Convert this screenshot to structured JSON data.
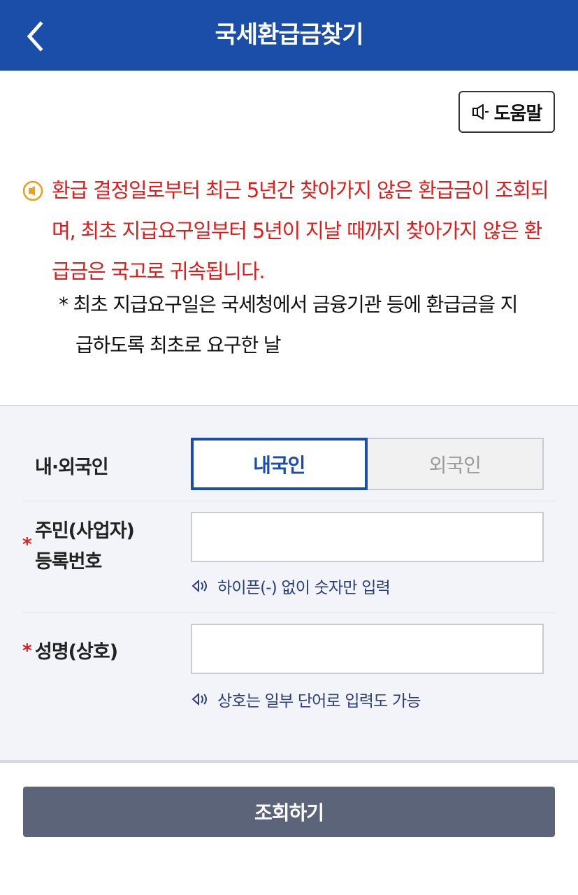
{
  "header": {
    "title": "국세환급금찾기"
  },
  "help": {
    "label": "도움말"
  },
  "notice": {
    "lines": [
      "환급 결정일로부터 최근 5년간 찾아가지 않은 환급금이 조회되",
      "며, 최초 지급요구일부터 5년이 지날 때까지 찾아가지 않은 환",
      "급금은 국고로 귀속됩니다."
    ],
    "sub_lines": [
      "* 최초 지급요구일은 국세청에서 금융기관 등에 환급금을 지",
      "급하도록 최초로 요구한 날"
    ]
  },
  "form": {
    "nationality": {
      "label": "내·외국인",
      "options": [
        "내국인",
        "외국인"
      ],
      "selected": "내국인"
    },
    "id_number": {
      "required_mark": "*",
      "label_line1": "주민(사업자)",
      "label_line2": "등록번호",
      "value": "",
      "hint": "하이픈(-) 없이 숫자만 입력"
    },
    "name": {
      "required_mark": "*",
      "label": "성명(상호)",
      "value": "",
      "hint": "상호는 일부 단어로 입력도 가능"
    }
  },
  "submit": {
    "label": "조회하기"
  },
  "colors": {
    "header": "#1b4ea8",
    "notice": "#e21c1c",
    "button": "#5b6479",
    "panel": "#f3f4f9"
  }
}
